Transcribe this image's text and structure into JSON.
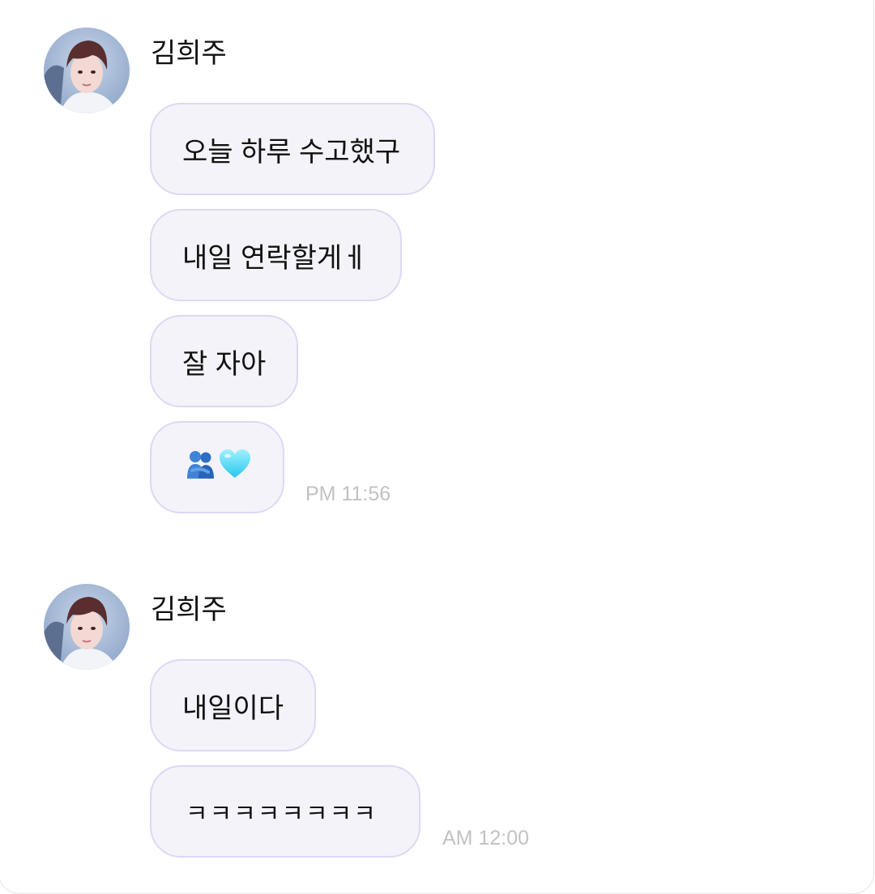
{
  "messages": [
    {
      "sender": "김희주",
      "avatar_icon": "profile-photo-icon",
      "bubbles": [
        "오늘 하루 수고했구",
        "내일 연락할게ㅔ",
        "잘 자아",
        ""
      ],
      "emoji_bubble_icons": [
        "people-hugging-icon",
        "light-blue-heart-icon"
      ],
      "time": "PM 11:56"
    },
    {
      "sender": "김희주",
      "avatar_icon": "profile-photo-icon",
      "bubbles": [
        "내일이다",
        "ㅋㅋㅋㅋㅋㅋㅋㅋ"
      ],
      "time": "AM 12:00"
    }
  ],
  "colors": {
    "bubble_bg": "#f3f3f9",
    "bubble_border": "#ded8f6",
    "time_text": "#c2c2c2"
  }
}
